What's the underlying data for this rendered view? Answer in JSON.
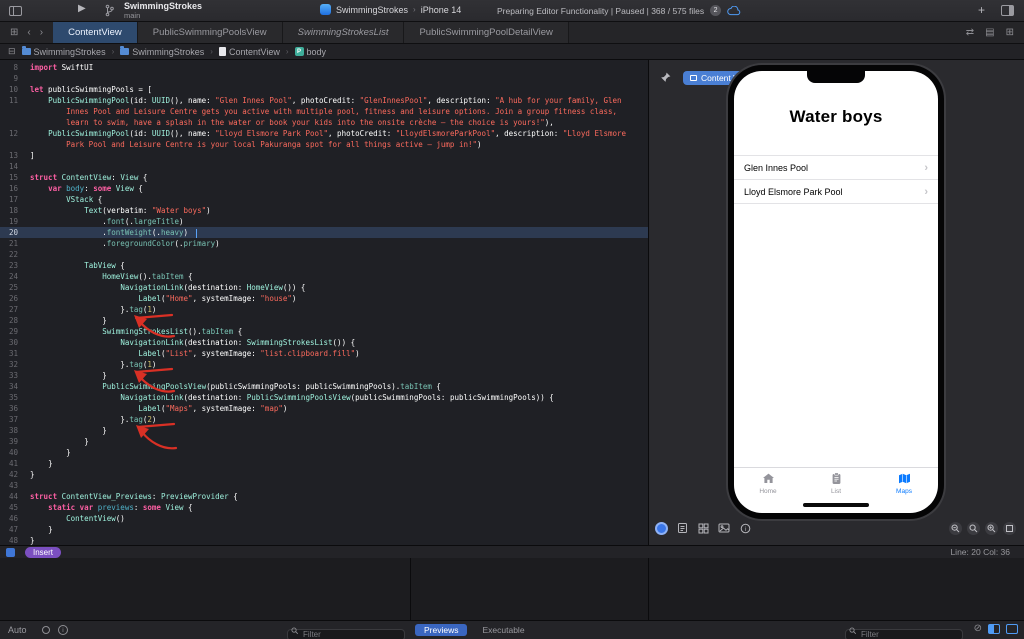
{
  "toolbar": {
    "project": "SwimmingStrokes",
    "branch": "main",
    "scheme": "SwimmingStrokes",
    "destination": "iPhone 14",
    "status": "Preparing Editor Functionality | Paused | 368 / 575 files",
    "status_count": "2"
  },
  "editor_tabs": [
    {
      "label": "ContentView",
      "active": true,
      "italic": false
    },
    {
      "label": "PublicSwimmingPoolsView",
      "active": false,
      "italic": false
    },
    {
      "label": "SwimmingStrokesList",
      "active": false,
      "italic": true
    },
    {
      "label": "PublicSwimmingPoolDetailView",
      "active": false,
      "italic": false
    }
  ],
  "breadcrumb": [
    {
      "label": "SwimmingStrokes",
      "icon": "folder-icon"
    },
    {
      "label": "SwimmingStrokes",
      "icon": "folder-icon"
    },
    {
      "label": "ContentView",
      "icon": "swift-file-icon"
    },
    {
      "label": "body",
      "icon": "property-icon",
      "badge": "P"
    }
  ],
  "editor": {
    "highlight_line": 20,
    "lines": [
      {
        "n": 8,
        "t": [
          [
            "kw",
            "import"
          ],
          [
            "p",
            " SwiftUI"
          ]
        ]
      },
      {
        "n": 9,
        "t": []
      },
      {
        "n": 10,
        "t": [
          [
            "kw",
            "let"
          ],
          [
            "p",
            " publicSwimmingPools = ["
          ]
        ]
      },
      {
        "n": 11,
        "t": [
          [
            "p",
            "    "
          ],
          [
            "ty",
            "PublicSwimmingPool"
          ],
          [
            "p",
            "(id: "
          ],
          [
            "ty",
            "UUID"
          ],
          [
            "p",
            "(), name: "
          ],
          [
            "str",
            "\"Glen Innes Pool\""
          ],
          [
            "p",
            ", photoCredit: "
          ],
          [
            "str",
            "\"GlenInnesPool\""
          ],
          [
            "p",
            ", description: "
          ],
          [
            "str",
            "\"A hub for your family, Glen Innes Pool and Leisure Centre gets you active with multiple pool, fitness and leisure options. Join a group fitness class, learn to swim, have a splash in the water or book your kids into the onsite crèche — the choice is yours!\""
          ],
          [
            "p",
            "),"
          ]
        ]
      },
      {
        "n": 12,
        "t": [
          [
            "p",
            "    "
          ],
          [
            "ty",
            "PublicSwimmingPool"
          ],
          [
            "p",
            "(id: "
          ],
          [
            "ty",
            "UUID"
          ],
          [
            "p",
            "(), name: "
          ],
          [
            "str",
            "\"Lloyd Elsmore Park Pool\""
          ],
          [
            "p",
            ", photoCredit: "
          ],
          [
            "str",
            "\"LloydElsmoreParkPool\""
          ],
          [
            "p",
            ", description: "
          ],
          [
            "str",
            "\"Lloyd Elsmore Park Pool and Leisure Centre is your local Pakuranga spot for all things active — jump in!\""
          ],
          [
            "p",
            ")"
          ]
        ]
      },
      {
        "n": 13,
        "t": [
          [
            "p",
            "]"
          ]
        ]
      },
      {
        "n": 14,
        "t": []
      },
      {
        "n": 15,
        "t": [
          [
            "kw",
            "struct"
          ],
          [
            "p",
            " "
          ],
          [
            "ty",
            "ContentView"
          ],
          [
            "p",
            ": "
          ],
          [
            "ty",
            "View"
          ],
          [
            "p",
            " {"
          ]
        ]
      },
      {
        "n": 16,
        "t": [
          [
            "p",
            "    "
          ],
          [
            "kw",
            "var"
          ],
          [
            "p",
            " "
          ],
          [
            "decl",
            "body"
          ],
          [
            "p",
            ": "
          ],
          [
            "kw",
            "some"
          ],
          [
            "p",
            " "
          ],
          [
            "ty",
            "View"
          ],
          [
            "p",
            " {"
          ]
        ]
      },
      {
        "n": 17,
        "t": [
          [
            "p",
            "        "
          ],
          [
            "ty",
            "VStack"
          ],
          [
            "p",
            " {"
          ]
        ]
      },
      {
        "n": 18,
        "t": [
          [
            "p",
            "            "
          ],
          [
            "ty",
            "Text"
          ],
          [
            "p",
            "(verbatim: "
          ],
          [
            "str",
            "\"Water boys\""
          ],
          [
            "p",
            ")"
          ]
        ]
      },
      {
        "n": 19,
        "t": [
          [
            "p",
            "                ."
          ],
          [
            "mem",
            "font"
          ],
          [
            "p",
            "(."
          ],
          [
            "mem",
            "largeTitle"
          ],
          [
            "p",
            ")"
          ]
        ]
      },
      {
        "n": 20,
        "t": [
          [
            "p",
            "                ."
          ],
          [
            "mem",
            "fontWeight"
          ],
          [
            "p",
            "(."
          ],
          [
            "mem",
            "heavy"
          ],
          [
            "p",
            ")"
          ]
        ]
      },
      {
        "n": 21,
        "t": [
          [
            "p",
            "                ."
          ],
          [
            "mem",
            "foregroundColor"
          ],
          [
            "p",
            "(."
          ],
          [
            "mem",
            "primary"
          ],
          [
            "p",
            ")"
          ]
        ]
      },
      {
        "n": 22,
        "t": []
      },
      {
        "n": 23,
        "t": [
          [
            "p",
            "            "
          ],
          [
            "ty",
            "TabView"
          ],
          [
            "p",
            " {"
          ]
        ]
      },
      {
        "n": 24,
        "t": [
          [
            "p",
            "                "
          ],
          [
            "ty",
            "HomeView"
          ],
          [
            "p",
            "()."
          ],
          [
            "mem",
            "tabItem"
          ],
          [
            "p",
            " {"
          ]
        ]
      },
      {
        "n": 25,
        "t": [
          [
            "p",
            "                    "
          ],
          [
            "ty",
            "NavigationLink"
          ],
          [
            "p",
            "(destination: "
          ],
          [
            "ty",
            "HomeView"
          ],
          [
            "p",
            "()) {"
          ]
        ]
      },
      {
        "n": 26,
        "t": [
          [
            "p",
            "                        "
          ],
          [
            "ty",
            "Label"
          ],
          [
            "p",
            "("
          ],
          [
            "str",
            "\"Home\""
          ],
          [
            "p",
            ", systemImage: "
          ],
          [
            "str",
            "\"house\""
          ],
          [
            "p",
            ")"
          ]
        ]
      },
      {
        "n": 27,
        "t": [
          [
            "p",
            "                    }."
          ],
          [
            "mem",
            "tag"
          ],
          [
            "p",
            "("
          ],
          [
            "num",
            "1"
          ],
          [
            "p",
            ")"
          ]
        ]
      },
      {
        "n": 28,
        "t": [
          [
            "p",
            "                }"
          ]
        ]
      },
      {
        "n": 29,
        "t": [
          [
            "p",
            "                "
          ],
          [
            "ty",
            "SwimmingStrokesList"
          ],
          [
            "p",
            "()."
          ],
          [
            "mem",
            "tabItem"
          ],
          [
            "p",
            " {"
          ]
        ]
      },
      {
        "n": 30,
        "t": [
          [
            "p",
            "                    "
          ],
          [
            "ty",
            "NavigationLink"
          ],
          [
            "p",
            "(destination: "
          ],
          [
            "ty",
            "SwimmingStrokesList"
          ],
          [
            "p",
            "()) {"
          ]
        ]
      },
      {
        "n": 31,
        "t": [
          [
            "p",
            "                        "
          ],
          [
            "ty",
            "Label"
          ],
          [
            "p",
            "("
          ],
          [
            "str",
            "\"List\""
          ],
          [
            "p",
            ", systemImage: "
          ],
          [
            "str",
            "\"list.clipboard.fill\""
          ],
          [
            "p",
            ")"
          ]
        ]
      },
      {
        "n": 32,
        "t": [
          [
            "p",
            "                    }."
          ],
          [
            "mem",
            "tag"
          ],
          [
            "p",
            "("
          ],
          [
            "num",
            "1"
          ],
          [
            "p",
            ")"
          ]
        ]
      },
      {
        "n": 33,
        "t": [
          [
            "p",
            "                }"
          ]
        ]
      },
      {
        "n": 34,
        "t": [
          [
            "p",
            "                "
          ],
          [
            "ty",
            "PublicSwimmingPoolsView"
          ],
          [
            "p",
            "(publicSwimmingPools: publicSwimmingPools)."
          ],
          [
            "mem",
            "tabItem"
          ],
          [
            "p",
            " {"
          ]
        ]
      },
      {
        "n": 35,
        "t": [
          [
            "p",
            "                    "
          ],
          [
            "ty",
            "NavigationLink"
          ],
          [
            "p",
            "(destination: "
          ],
          [
            "ty",
            "PublicSwimmingPoolsView"
          ],
          [
            "p",
            "(publicSwimmingPools: publicSwimmingPools)) {"
          ]
        ]
      },
      {
        "n": 36,
        "t": [
          [
            "p",
            "                        "
          ],
          [
            "ty",
            "Label"
          ],
          [
            "p",
            "("
          ],
          [
            "str",
            "\"Maps\""
          ],
          [
            "p",
            ", systemImage: "
          ],
          [
            "str",
            "\"map\""
          ],
          [
            "p",
            ")"
          ]
        ]
      },
      {
        "n": 37,
        "t": [
          [
            "p",
            "                    }."
          ],
          [
            "mem",
            "tag"
          ],
          [
            "p",
            "("
          ],
          [
            "num",
            "2"
          ],
          [
            "p",
            ")"
          ]
        ]
      },
      {
        "n": 38,
        "t": [
          [
            "p",
            "                }"
          ]
        ]
      },
      {
        "n": 39,
        "t": [
          [
            "p",
            "            }"
          ]
        ]
      },
      {
        "n": 40,
        "t": [
          [
            "p",
            "        }"
          ]
        ]
      },
      {
        "n": 41,
        "t": [
          [
            "p",
            "    }"
          ]
        ]
      },
      {
        "n": 42,
        "t": [
          [
            "p",
            "}"
          ]
        ]
      },
      {
        "n": 43,
        "t": []
      },
      {
        "n": 44,
        "t": [
          [
            "kw",
            "struct"
          ],
          [
            "p",
            " "
          ],
          [
            "ty",
            "ContentView_Previews"
          ],
          [
            "p",
            ": "
          ],
          [
            "ty",
            "PreviewProvider"
          ],
          [
            "p",
            " {"
          ]
        ]
      },
      {
        "n": 45,
        "t": [
          [
            "p",
            "    "
          ],
          [
            "kw",
            "static"
          ],
          [
            "p",
            " "
          ],
          [
            "kw",
            "var"
          ],
          [
            "p",
            " "
          ],
          [
            "decl",
            "previews"
          ],
          [
            "p",
            ": "
          ],
          [
            "kw",
            "some"
          ],
          [
            "p",
            " "
          ],
          [
            "ty",
            "View"
          ],
          [
            "p",
            " {"
          ]
        ]
      },
      {
        "n": 46,
        "t": [
          [
            "p",
            "        "
          ],
          [
            "ty",
            "ContentView"
          ],
          [
            "p",
            "()"
          ]
        ]
      },
      {
        "n": 47,
        "t": [
          [
            "p",
            "    }"
          ]
        ]
      },
      {
        "n": 48,
        "t": [
          [
            "p",
            "}"
          ]
        ]
      }
    ]
  },
  "canvas": {
    "badge_label": "Content View",
    "preview": {
      "title": "Water boys",
      "rows": [
        "Glen Innes Pool",
        "Lloyd Elsmore Park Pool"
      ],
      "tab_items": [
        {
          "label": "Home",
          "icon": "house-icon",
          "active": false
        },
        {
          "label": "List",
          "icon": "list-icon",
          "active": false
        },
        {
          "label": "Maps",
          "icon": "map-icon",
          "active": true
        }
      ]
    }
  },
  "status_bar": {
    "mode": "Insert",
    "line_col": "Line: 20 Col: 36"
  },
  "bottom": {
    "auto_label": "Auto",
    "filter_placeholder": "Filter",
    "tabs": [
      {
        "label": "Previews",
        "active": true
      },
      {
        "label": "Executable",
        "active": false
      }
    ]
  }
}
